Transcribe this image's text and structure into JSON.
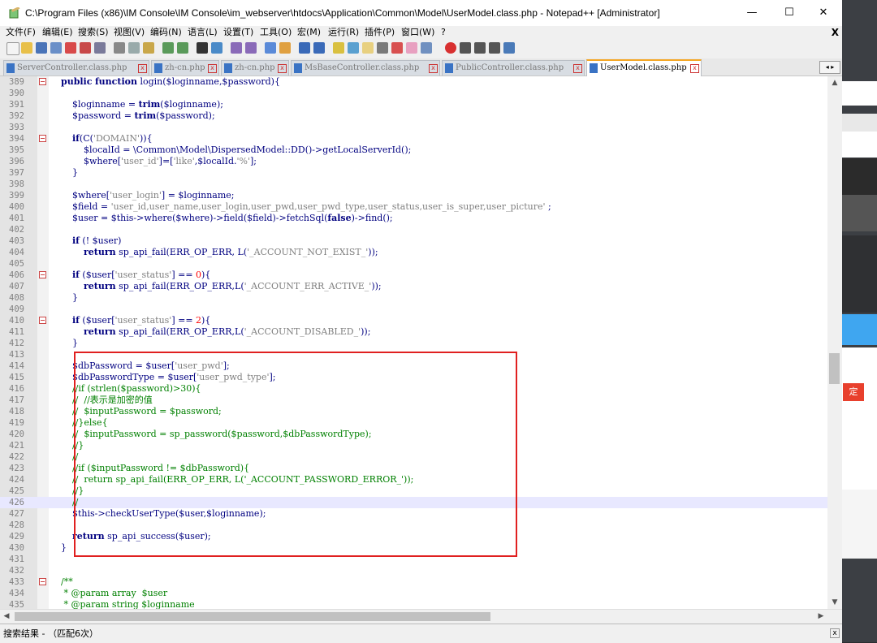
{
  "window": {
    "title": "C:\\Program Files (x86)\\IM Console\\IM Console\\im_webserver\\htdocs\\Application\\Common\\Model\\UserModel.class.php - Notepad++ [Administrator]",
    "minimize": "—",
    "maximize": "☐",
    "close": "✕"
  },
  "menu": {
    "items": [
      "文件(F)",
      "编辑(E)",
      "搜索(S)",
      "视图(V)",
      "编码(N)",
      "语言(L)",
      "设置(T)",
      "工具(O)",
      "宏(M)",
      "运行(R)",
      "插件(P)",
      "窗口(W)",
      "?"
    ],
    "close": "X"
  },
  "tabs": [
    {
      "label": "ServerController.class.php",
      "active": false
    },
    {
      "label": "zh-cn.php",
      "active": false
    },
    {
      "label": "zh-cn.php",
      "active": false
    },
    {
      "label": "MsBaseController.class.php",
      "active": false
    },
    {
      "label": "PublicController.class.php",
      "active": false
    },
    {
      "label": "UserModel.class.php",
      "active": true
    }
  ],
  "tab_close": "x",
  "tab_nav": "◂ ▸",
  "editor": {
    "lines": [
      {
        "num": "389",
        "text": "    public function login($loginname,$password){"
      },
      {
        "num": "390",
        "text": ""
      },
      {
        "num": "391",
        "text": "        $loginname = trim($loginname);"
      },
      {
        "num": "392",
        "text": "        $password = trim($password);"
      },
      {
        "num": "393",
        "text": ""
      },
      {
        "num": "394",
        "text": "        if(C('DOMAIN')){"
      },
      {
        "num": "395",
        "text": "            $localId = \\Common\\Model\\DispersedModel::DD()->getLocalServerId();"
      },
      {
        "num": "396",
        "text": "            $where['user_id']=['like',$localId.'%'];"
      },
      {
        "num": "397",
        "text": "        }"
      },
      {
        "num": "398",
        "text": ""
      },
      {
        "num": "399",
        "text": "        $where['user_login'] = $loginname;"
      },
      {
        "num": "400",
        "text": "        $field = 'user_id,user_name,user_login,user_pwd,user_pwd_type,user_status,user_is_super,user_picture' ;"
      },
      {
        "num": "401",
        "text": "        $user = $this->where($where)->field($field)->fetchSql(false)->find();"
      },
      {
        "num": "402",
        "text": ""
      },
      {
        "num": "403",
        "text": "        if (! $user)"
      },
      {
        "num": "404",
        "text": "            return sp_api_fail(ERR_OP_ERR, L('_ACCOUNT_NOT_EXIST_'));"
      },
      {
        "num": "405",
        "text": ""
      },
      {
        "num": "406",
        "text": "        if ($user['user_status'] == 0){"
      },
      {
        "num": "407",
        "text": "            return sp_api_fail(ERR_OP_ERR,L('_ACCOUNT_ERR_ACTIVE_'));"
      },
      {
        "num": "408",
        "text": "        }"
      },
      {
        "num": "409",
        "text": ""
      },
      {
        "num": "410",
        "text": "        if ($user['user_status'] == 2){"
      },
      {
        "num": "411",
        "text": "            return sp_api_fail(ERR_OP_ERR,L('_ACCOUNT_DISABLED_'));"
      },
      {
        "num": "412",
        "text": "        }"
      },
      {
        "num": "413",
        "text": ""
      },
      {
        "num": "414",
        "text": "        $dbPassword = $user['user_pwd'];"
      },
      {
        "num": "415",
        "text": "        $dbPasswordType = $user['user_pwd_type'];"
      },
      {
        "num": "416",
        "text": "        //if (strlen($password)>30){"
      },
      {
        "num": "417",
        "text": "        //  //表示是加密的值"
      },
      {
        "num": "418",
        "text": "        //  $inputPassword = $password;"
      },
      {
        "num": "419",
        "text": "        //}else{"
      },
      {
        "num": "420",
        "text": "        //  $inputPassword = sp_password($password,$dbPasswordType);"
      },
      {
        "num": "421",
        "text": "        //}"
      },
      {
        "num": "422",
        "text": "        //"
      },
      {
        "num": "423",
        "text": "        //if ($inputPassword != $dbPassword){"
      },
      {
        "num": "424",
        "text": "        //  return sp_api_fail(ERR_OP_ERR, L('_ACCOUNT_PASSWORD_ERROR_'));"
      },
      {
        "num": "425",
        "text": "        //}"
      },
      {
        "num": "426",
        "text": "        //"
      },
      {
        "num": "427",
        "text": "        $this->checkUserType($user,$loginname);"
      },
      {
        "num": "428",
        "text": ""
      },
      {
        "num": "429",
        "text": "        return sp_api_success($user);"
      },
      {
        "num": "430",
        "text": "    }"
      },
      {
        "num": "431",
        "text": ""
      },
      {
        "num": "432",
        "text": ""
      },
      {
        "num": "433",
        "text": "    /**"
      },
      {
        "num": "434",
        "text": "     * @param array  $user"
      },
      {
        "num": "435",
        "text": "     * @param string $loginname"
      }
    ],
    "current_line": "426"
  },
  "scroll": {
    "up": "▲",
    "down": "▼",
    "left": "◀",
    "right": "▶"
  },
  "results": {
    "label": "搜索结果 - （匹配6次）",
    "close": "x"
  },
  "background_badge": "定"
}
